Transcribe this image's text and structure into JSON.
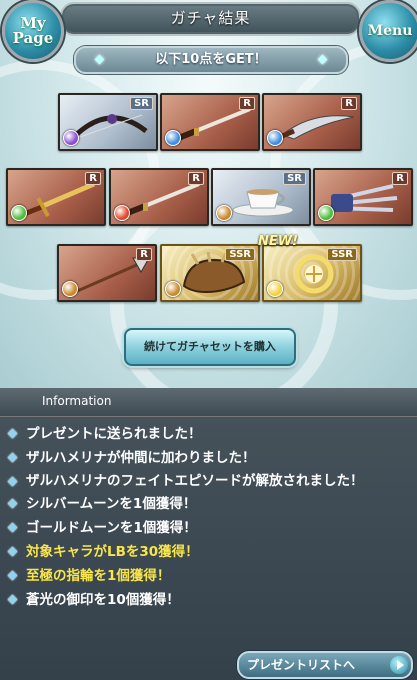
{
  "header": {
    "title": "ガチャ結果",
    "mypage_label_1": "My",
    "mypage_label_2": "Page",
    "menu_label": "Menu"
  },
  "get_banner": "以下10点をGET！",
  "cards": [
    {
      "rarity": "SR",
      "element": "dark",
      "item": "bow"
    },
    {
      "rarity": "R",
      "element": "water",
      "item": "katana"
    },
    {
      "rarity": "R",
      "element": "water",
      "item": "dagger"
    },
    {
      "rarity": "R",
      "element": "wind",
      "item": "sword"
    },
    {
      "rarity": "R",
      "element": "fire",
      "item": "katana"
    },
    {
      "rarity": "SR",
      "element": "earth",
      "item": "teacup"
    },
    {
      "rarity": "R",
      "element": "wind",
      "item": "claw"
    },
    {
      "rarity": "R",
      "element": "earth",
      "item": "spear"
    },
    {
      "rarity": "SSR",
      "element": "earth",
      "item": "gauntlet"
    },
    {
      "rarity": "SSR",
      "element": "light",
      "item": "summon"
    }
  ],
  "new_badge": "NEW!",
  "buy_button": "続けてガチャセットを購入",
  "info": {
    "title": "Information",
    "rows": [
      {
        "text": "プレゼントに送られました！",
        "color": "#ffffff"
      },
      {
        "text": "ザルハメリナが仲間に加わりました！",
        "color": "#ffffff"
      },
      {
        "text": "ザルハメリナのフェイトエピソードが解放されました！",
        "color": "#ffffff"
      },
      {
        "text": "シルバームーンを1個獲得！",
        "color": "#ffffff"
      },
      {
        "text": "ゴールドムーンを1個獲得！",
        "color": "#ffffff"
      },
      {
        "text": "対象キャラがLBを30獲得！",
        "color": "#f7e54b"
      },
      {
        "text": "至極の指輪を1個獲得！",
        "color": "#f7e54b"
      },
      {
        "text": "蒼光の御印を10個獲得！",
        "color": "#ffffff"
      }
    ]
  },
  "present_list_button": "プレゼントリストへ",
  "colors": {
    "dark": "#8a4fd0",
    "water": "#3e8fe0",
    "wind": "#4cbf3a",
    "fire": "#e2462c",
    "earth": "#c98a2a",
    "light": "#f2d13a"
  }
}
